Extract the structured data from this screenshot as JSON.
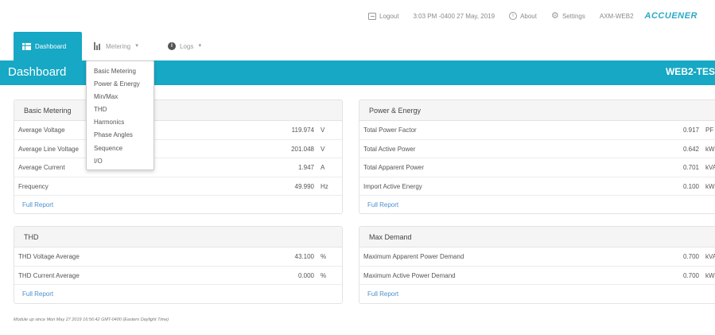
{
  "topbar": {
    "logout_label": "Logout",
    "datetime": "3:03 PM -0400 27 May, 2019",
    "about_label": "About",
    "settings_label": "Settings",
    "device_name": "AXM-WEB2",
    "brand": "ACCUENER"
  },
  "nav": {
    "dashboard_label": "Dashboard",
    "metering_label": "Metering",
    "logs_label": "Logs"
  },
  "banner": {
    "title": "Dashboard",
    "device": "WEB2-TES"
  },
  "metering_menu": [
    "Basic Metering",
    "Power & Energy",
    "Min/Max",
    "THD",
    "Harmonics",
    "Phase Angles",
    "Sequence",
    "I/O"
  ],
  "panels": {
    "basic_metering": {
      "title": "Basic Metering",
      "rows": [
        {
          "label": "Average Voltage",
          "value": "119.974",
          "unit": "V"
        },
        {
          "label": "Average Line Voltage",
          "value": "201.048",
          "unit": "V"
        },
        {
          "label": "Average Current",
          "value": "1.947",
          "unit": "A"
        },
        {
          "label": "Frequency",
          "value": "49.990",
          "unit": "Hz"
        }
      ],
      "link": "Full Report"
    },
    "power_energy": {
      "title": "Power & Energy",
      "rows": [
        {
          "label": "Total Power Factor",
          "value": "0.917",
          "unit": "PF"
        },
        {
          "label": "Total Active Power",
          "value": "0.642",
          "unit": "kW"
        },
        {
          "label": "Total Apparent Power",
          "value": "0.701",
          "unit": "kVA"
        },
        {
          "label": "Import Active Energy",
          "value": "0.100",
          "unit": "kWh"
        }
      ],
      "link": "Full Report"
    },
    "thd": {
      "title": "THD",
      "rows": [
        {
          "label": "THD Voltage Average",
          "value": "43.100",
          "unit": "%"
        },
        {
          "label": "THD Current Average",
          "value": "0.000",
          "unit": "%"
        }
      ],
      "link": "Full Report"
    },
    "max_demand": {
      "title": "Max Demand",
      "rows": [
        {
          "label": "Maximum Apparent Power Demand",
          "value": "0.700",
          "unit": "kVA"
        },
        {
          "label": "Maximum Active Power Demand",
          "value": "0.700",
          "unit": "kW"
        }
      ],
      "link": "Full Report"
    }
  },
  "footnote": "Module up since Mon May 27 2019 16:56:42 GMT-0400 (Eastern Daylight Time)"
}
